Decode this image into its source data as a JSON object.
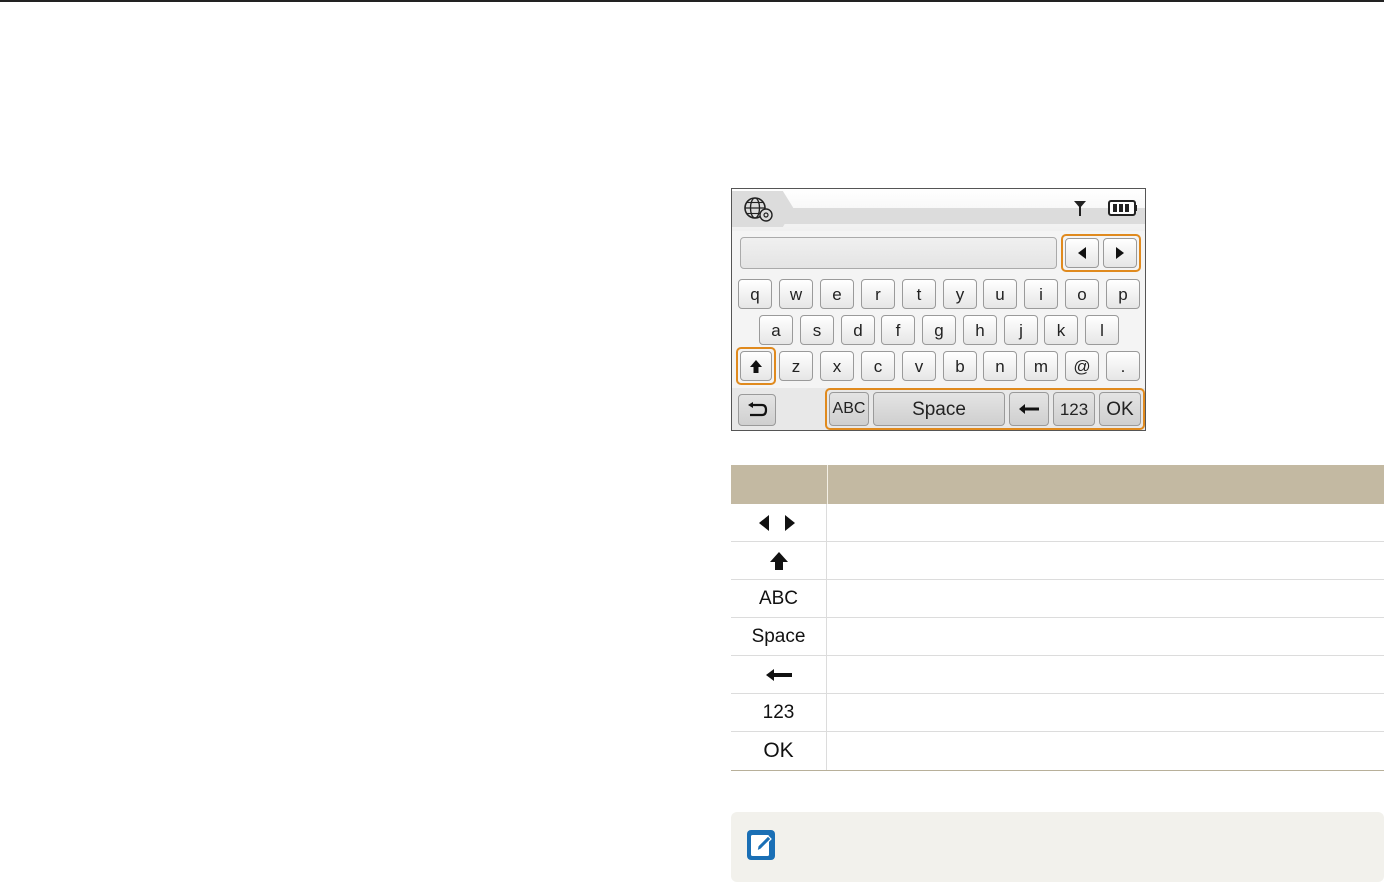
{
  "keyboard": {
    "row1": [
      "q",
      "w",
      "e",
      "r",
      "t",
      "y",
      "u",
      "i",
      "o",
      "p"
    ],
    "row2": [
      "a",
      "s",
      "d",
      "f",
      "g",
      "h",
      "j",
      "k",
      "l"
    ],
    "row3": [
      "z",
      "x",
      "c",
      "v",
      "b",
      "n",
      "m",
      "@",
      "."
    ],
    "abc_label": "ABC",
    "space_label": "Space",
    "num_label": "123",
    "ok_label": "OK",
    "icons": {
      "settings": "globe-settings-icon",
      "signal": "antenna-icon",
      "battery": "battery-icon",
      "left": "arrow-left-icon",
      "right": "arrow-right-icon",
      "shift": "shift-up-icon",
      "back": "return-icon",
      "backspace": "backspace-arrow-icon"
    }
  },
  "table": {
    "rows": [
      {
        "icon": "left-right-arrows-icon",
        "label": ""
      },
      {
        "icon": "shift-up-icon",
        "label": ""
      },
      {
        "icon": "",
        "label": "ABC"
      },
      {
        "icon": "",
        "label": "Space"
      },
      {
        "icon": "backspace-arrow-icon",
        "label": ""
      },
      {
        "icon": "",
        "label": "123"
      },
      {
        "icon": "",
        "label": "OK"
      }
    ]
  },
  "note": {
    "icon": "note-pencil-icon"
  },
  "colors": {
    "highlight": "#e08a1e",
    "table_header": "#c3b9a2",
    "note_icon": "#1a6fb5"
  }
}
